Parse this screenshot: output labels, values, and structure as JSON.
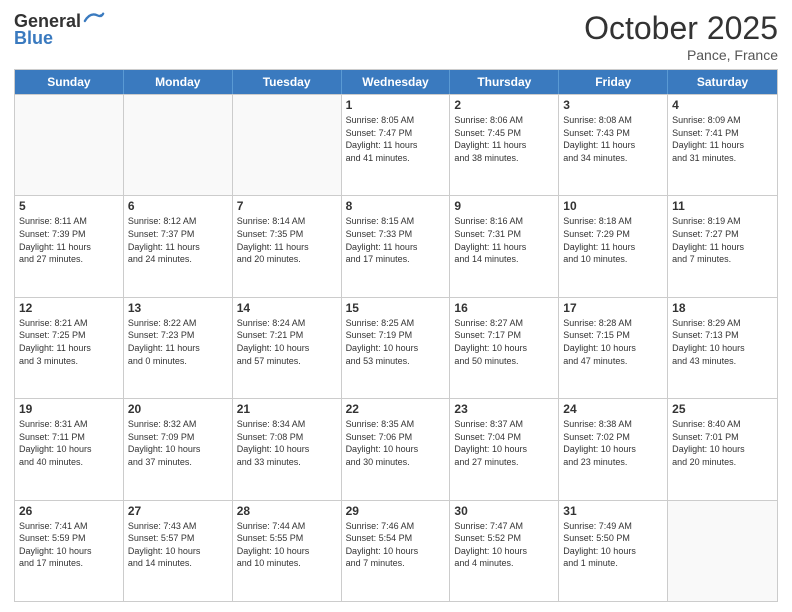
{
  "header": {
    "logo_general": "General",
    "logo_blue": "Blue",
    "month": "October 2025",
    "location": "Pance, France"
  },
  "weekdays": [
    "Sunday",
    "Monday",
    "Tuesday",
    "Wednesday",
    "Thursday",
    "Friday",
    "Saturday"
  ],
  "rows": [
    [
      {
        "day": "",
        "text": "",
        "empty": true
      },
      {
        "day": "",
        "text": "",
        "empty": true
      },
      {
        "day": "",
        "text": "",
        "empty": true
      },
      {
        "day": "1",
        "text": "Sunrise: 8:05 AM\nSunset: 7:47 PM\nDaylight: 11 hours\nand 41 minutes."
      },
      {
        "day": "2",
        "text": "Sunrise: 8:06 AM\nSunset: 7:45 PM\nDaylight: 11 hours\nand 38 minutes."
      },
      {
        "day": "3",
        "text": "Sunrise: 8:08 AM\nSunset: 7:43 PM\nDaylight: 11 hours\nand 34 minutes."
      },
      {
        "day": "4",
        "text": "Sunrise: 8:09 AM\nSunset: 7:41 PM\nDaylight: 11 hours\nand 31 minutes."
      }
    ],
    [
      {
        "day": "5",
        "text": "Sunrise: 8:11 AM\nSunset: 7:39 PM\nDaylight: 11 hours\nand 27 minutes."
      },
      {
        "day": "6",
        "text": "Sunrise: 8:12 AM\nSunset: 7:37 PM\nDaylight: 11 hours\nand 24 minutes."
      },
      {
        "day": "7",
        "text": "Sunrise: 8:14 AM\nSunset: 7:35 PM\nDaylight: 11 hours\nand 20 minutes."
      },
      {
        "day": "8",
        "text": "Sunrise: 8:15 AM\nSunset: 7:33 PM\nDaylight: 11 hours\nand 17 minutes."
      },
      {
        "day": "9",
        "text": "Sunrise: 8:16 AM\nSunset: 7:31 PM\nDaylight: 11 hours\nand 14 minutes."
      },
      {
        "day": "10",
        "text": "Sunrise: 8:18 AM\nSunset: 7:29 PM\nDaylight: 11 hours\nand 10 minutes."
      },
      {
        "day": "11",
        "text": "Sunrise: 8:19 AM\nSunset: 7:27 PM\nDaylight: 11 hours\nand 7 minutes."
      }
    ],
    [
      {
        "day": "12",
        "text": "Sunrise: 8:21 AM\nSunset: 7:25 PM\nDaylight: 11 hours\nand 3 minutes."
      },
      {
        "day": "13",
        "text": "Sunrise: 8:22 AM\nSunset: 7:23 PM\nDaylight: 11 hours\nand 0 minutes."
      },
      {
        "day": "14",
        "text": "Sunrise: 8:24 AM\nSunset: 7:21 PM\nDaylight: 10 hours\nand 57 minutes."
      },
      {
        "day": "15",
        "text": "Sunrise: 8:25 AM\nSunset: 7:19 PM\nDaylight: 10 hours\nand 53 minutes."
      },
      {
        "day": "16",
        "text": "Sunrise: 8:27 AM\nSunset: 7:17 PM\nDaylight: 10 hours\nand 50 minutes."
      },
      {
        "day": "17",
        "text": "Sunrise: 8:28 AM\nSunset: 7:15 PM\nDaylight: 10 hours\nand 47 minutes."
      },
      {
        "day": "18",
        "text": "Sunrise: 8:29 AM\nSunset: 7:13 PM\nDaylight: 10 hours\nand 43 minutes."
      }
    ],
    [
      {
        "day": "19",
        "text": "Sunrise: 8:31 AM\nSunset: 7:11 PM\nDaylight: 10 hours\nand 40 minutes."
      },
      {
        "day": "20",
        "text": "Sunrise: 8:32 AM\nSunset: 7:09 PM\nDaylight: 10 hours\nand 37 minutes."
      },
      {
        "day": "21",
        "text": "Sunrise: 8:34 AM\nSunset: 7:08 PM\nDaylight: 10 hours\nand 33 minutes."
      },
      {
        "day": "22",
        "text": "Sunrise: 8:35 AM\nSunset: 7:06 PM\nDaylight: 10 hours\nand 30 minutes."
      },
      {
        "day": "23",
        "text": "Sunrise: 8:37 AM\nSunset: 7:04 PM\nDaylight: 10 hours\nand 27 minutes."
      },
      {
        "day": "24",
        "text": "Sunrise: 8:38 AM\nSunset: 7:02 PM\nDaylight: 10 hours\nand 23 minutes."
      },
      {
        "day": "25",
        "text": "Sunrise: 8:40 AM\nSunset: 7:01 PM\nDaylight: 10 hours\nand 20 minutes."
      }
    ],
    [
      {
        "day": "26",
        "text": "Sunrise: 7:41 AM\nSunset: 5:59 PM\nDaylight: 10 hours\nand 17 minutes."
      },
      {
        "day": "27",
        "text": "Sunrise: 7:43 AM\nSunset: 5:57 PM\nDaylight: 10 hours\nand 14 minutes."
      },
      {
        "day": "28",
        "text": "Sunrise: 7:44 AM\nSunset: 5:55 PM\nDaylight: 10 hours\nand 10 minutes."
      },
      {
        "day": "29",
        "text": "Sunrise: 7:46 AM\nSunset: 5:54 PM\nDaylight: 10 hours\nand 7 minutes."
      },
      {
        "day": "30",
        "text": "Sunrise: 7:47 AM\nSunset: 5:52 PM\nDaylight: 10 hours\nand 4 minutes."
      },
      {
        "day": "31",
        "text": "Sunrise: 7:49 AM\nSunset: 5:50 PM\nDaylight: 10 hours\nand 1 minute."
      },
      {
        "day": "",
        "text": "",
        "empty": true
      }
    ]
  ]
}
